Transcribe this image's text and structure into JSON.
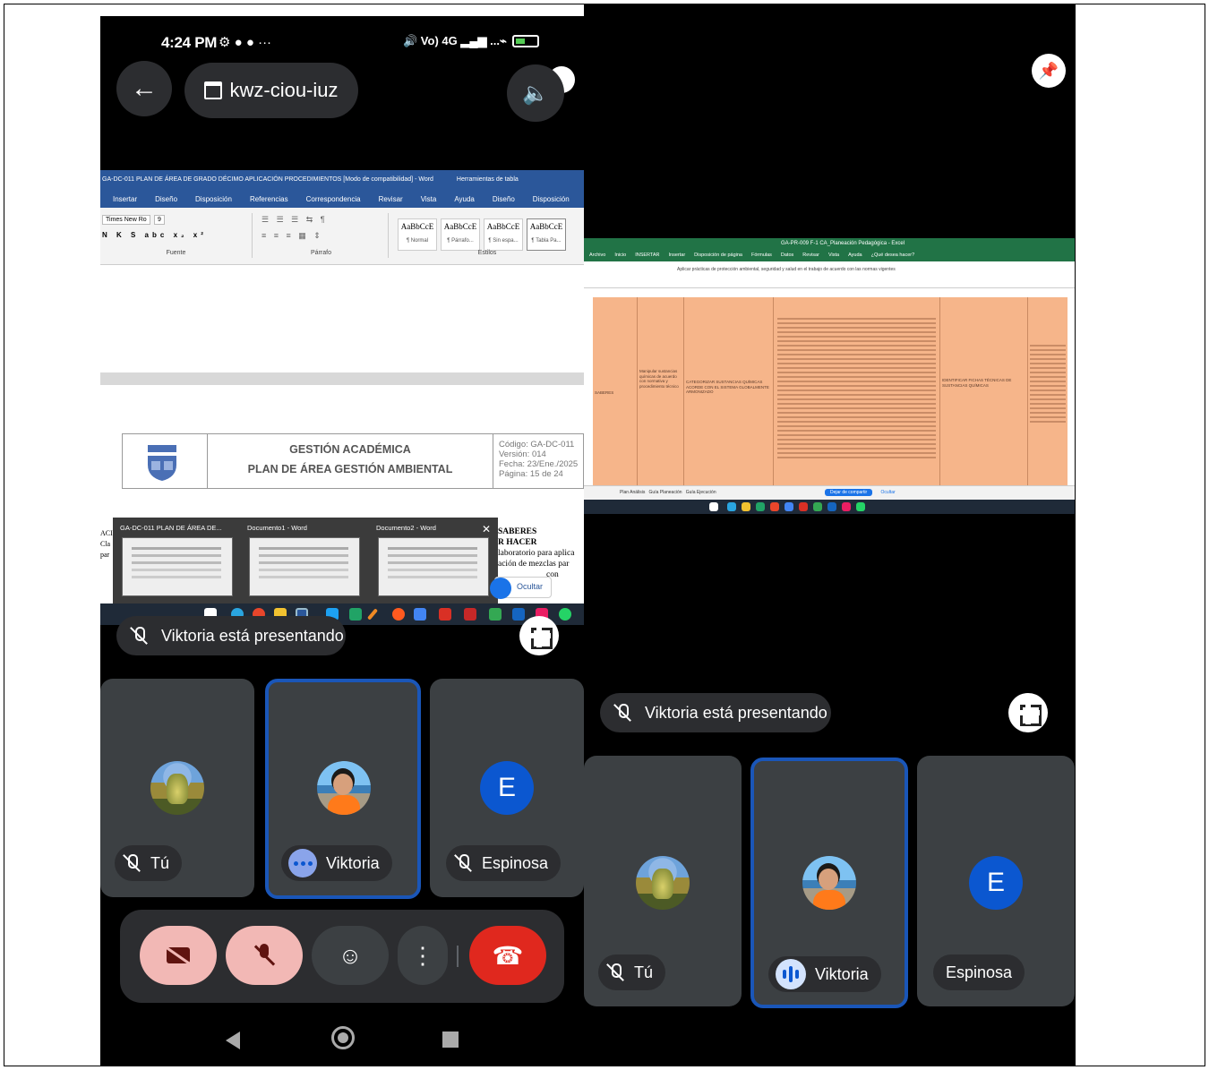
{
  "left": {
    "status": {
      "time": "4:24 PM",
      "notif_icons": "⚙ ● ● ···",
      "network": "🔊 Vo) 4G ▂▄▆ ...⌁"
    },
    "meeting_code": "kwz-ciou-iuz",
    "word": {
      "title": "GA-DC-011 PLAN DE ÁREA DE GRADO DÉCIMO APLICACIÓN PROCEDIMIENTOS [Modo de compatibilidad] - Word",
      "tools_label": "Herramientas de tabla",
      "tabs": [
        "Insertar",
        "Diseño",
        "Disposición",
        "Referencias",
        "Correspondencia",
        "Revisar",
        "Vista",
        "Ayuda",
        "Diseño",
        "Disposición"
      ],
      "font_name": "Times New Ro",
      "font_size": "9",
      "group_labels": [
        "Fuente",
        "Párrafo",
        "Estilos"
      ],
      "styles": [
        {
          "preview": "AaBbCcE",
          "name": "¶ Normal"
        },
        {
          "preview": "AaBbCcE",
          "name": "¶ Párrafo..."
        },
        {
          "preview": "AaBbCcE",
          "name": "¶ Sin espa..."
        },
        {
          "preview": "AaBbCcE",
          "name": "¶ Tabla Pa..."
        }
      ],
      "doc_header": {
        "line1": "GESTIÓN ACADÉMICA",
        "line2": "PLAN DE ÁREA GESTIÓN AMBIENTAL",
        "codigo": "Código: GA-DC-011",
        "version": "Versión: 014",
        "fecha": "Fecha: 23/Ene./2025",
        "pagina": "Página: 15 de 24"
      },
      "thumbnails": [
        {
          "title": "GA-DC-011 PLAN DE ÁREA DE..."
        },
        {
          "title": "Documento1 - Word"
        },
        {
          "title": "Documento2 - Word"
        }
      ],
      "serif_fragment": [
        "SABERES",
        "R HACER",
        "laboratorio para aplica",
        "ación de mezclas par",
        "con"
      ],
      "left_fragment": [
        "ACI",
        "",
        "Cla",
        "par"
      ],
      "ocultar": "Ocultar"
    },
    "presenting": "Viktoria está presentando",
    "participants": [
      {
        "name": "Tú",
        "avatar": "plant"
      },
      {
        "name": "Viktoria",
        "avatar": "person"
      },
      {
        "name": "Espinosa",
        "avatar": "E"
      }
    ]
  },
  "right": {
    "excel": {
      "title": "GA-PR-009 F-1 CA_Planeación Pedagógica - Excel",
      "tabs": [
        "Archivo",
        "Inicio",
        "INSERTAR",
        "Insertar",
        "Disposición de página",
        "Fórmulas",
        "Datos",
        "Revisar",
        "Vista",
        "Ayuda",
        "¿Qué desea hacer?"
      ],
      "formula": "Aplicar prácticas de protección ambiental, seguridad y salud en el trabajo de acuerdo con las normas vigentes",
      "row_label": "SABERES",
      "col2_text": "Manipular sustancias químicas de acuerdo con normativa y procedimiento técnico",
      "col3_text": "CATEGORIZAR SUSTANCIAS QUÍMICAS ACORDE CON EL SISTEMA GLOBALMENTE ARMONIZADO",
      "col6_text": "IDENTIFICAR FICHAS TÉCNICAS DE SUSTANCIAS QUÍMICAS",
      "sheet_tabs": [
        "Plan Análisis",
        "Guía Planeación",
        "Guía Ejecución"
      ],
      "dejar_btn": "Dejar de compartir",
      "ocultar": "Ocultar"
    },
    "presenting": "Viktoria está presentando",
    "participants": [
      {
        "name": "Tú",
        "avatar": "plant"
      },
      {
        "name": "Viktoria",
        "avatar": "person"
      },
      {
        "name": "Espinosa",
        "avatar": "E"
      }
    ]
  }
}
